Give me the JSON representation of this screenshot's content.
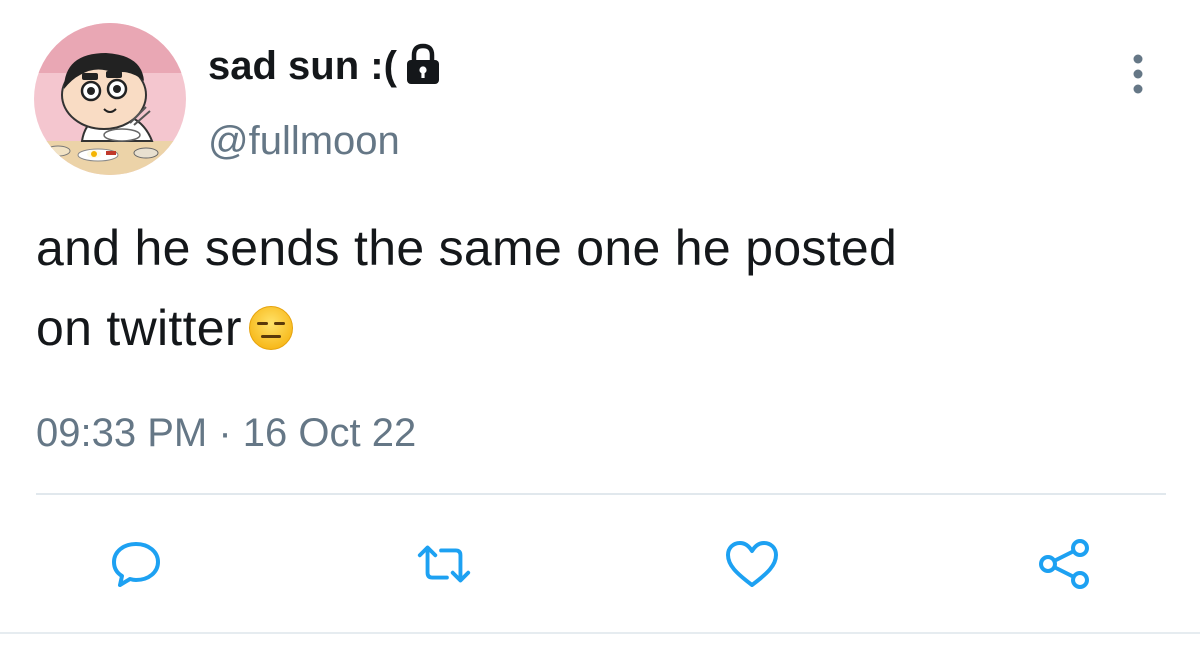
{
  "user": {
    "display_name": "sad sun :(",
    "handle": "@fullmoon",
    "protected_icon": "lock-icon",
    "avatar_icon": "avatar-image"
  },
  "tweet": {
    "text_line1": "and he sends the same one he posted",
    "text_line2": "on twitter",
    "emoji": "expressionless-face-emoji",
    "timestamp": "09:33 PM · 16 Oct 22"
  },
  "actions": [
    {
      "name": "reply",
      "icon": "comment-icon"
    },
    {
      "name": "retweet",
      "icon": "retweet-icon"
    },
    {
      "name": "like",
      "icon": "heart-icon"
    },
    {
      "name": "share",
      "icon": "share-icon"
    }
  ],
  "menu": {
    "icon": "more-vertical-icon"
  },
  "colors": {
    "text": "#14171a",
    "secondary": "#657786",
    "icon": "#1da1f2",
    "divider": "#e1e8ed"
  }
}
